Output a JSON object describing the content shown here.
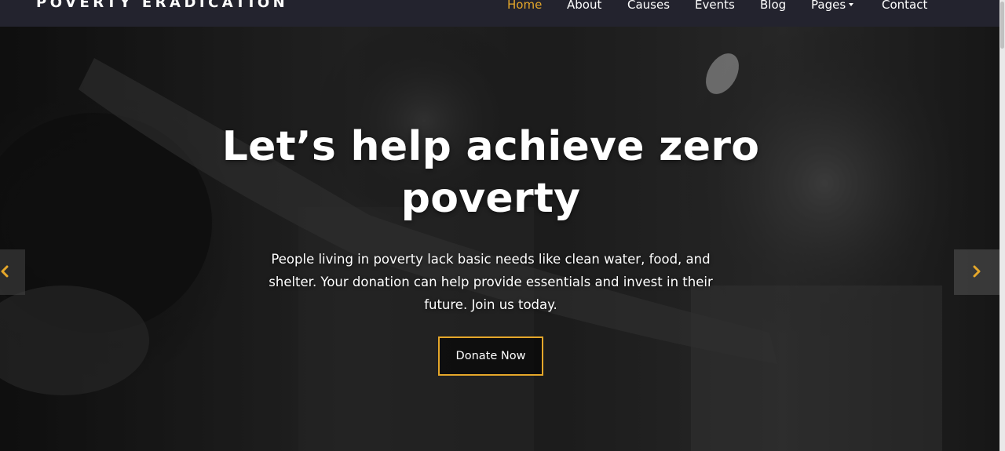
{
  "brand": {
    "name": "POVERTY ERADICATION"
  },
  "nav": {
    "items": [
      {
        "label": "Home",
        "active": true
      },
      {
        "label": "About"
      },
      {
        "label": "Causes"
      },
      {
        "label": "Events"
      },
      {
        "label": "Blog"
      },
      {
        "label": "Pages",
        "has_dropdown": true
      },
      {
        "label": "Contact"
      }
    ]
  },
  "hero": {
    "title_line1": "Let’s help achieve zero",
    "title_line2": "poverty",
    "desc_line1": "People living in poverty lack basic needs like clean water, food, and",
    "desc_line2": "shelter. Your donation can help provide essentials and invest in their",
    "desc_line3": "future. Join us today.",
    "cta_label": "Donate Now",
    "prev_icon": "chevron-left-icon",
    "next_icon": "chevron-right-icon"
  },
  "colors": {
    "navbar_bg": "#23232e",
    "accent": "#e5a72a",
    "text": "#ffffff"
  }
}
